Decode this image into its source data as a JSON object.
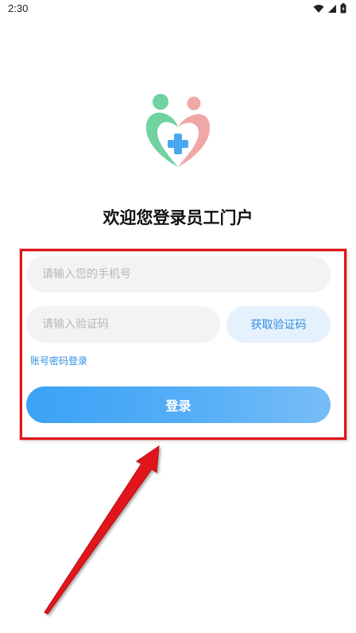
{
  "status_bar": {
    "time": "2:30",
    "icons": [
      "wifi-icon",
      "cellular-signal-icon",
      "battery-icon"
    ]
  },
  "logo": {
    "icon": "care-heart-logo",
    "colors": {
      "green": "#6fd2a0",
      "pink": "#f0a7a7",
      "blue": "#4aa8f0"
    }
  },
  "login": {
    "title": "欢迎您登录员工门户",
    "phone_placeholder": "请输入您的手机号",
    "code_placeholder": "请输入验证码",
    "get_code_label": "获取验证码",
    "password_login_link": "账号密码登录",
    "login_button_label": "登录"
  },
  "annotation": {
    "highlight_color": "#e0141a",
    "arrow_color": "#e0141a"
  }
}
